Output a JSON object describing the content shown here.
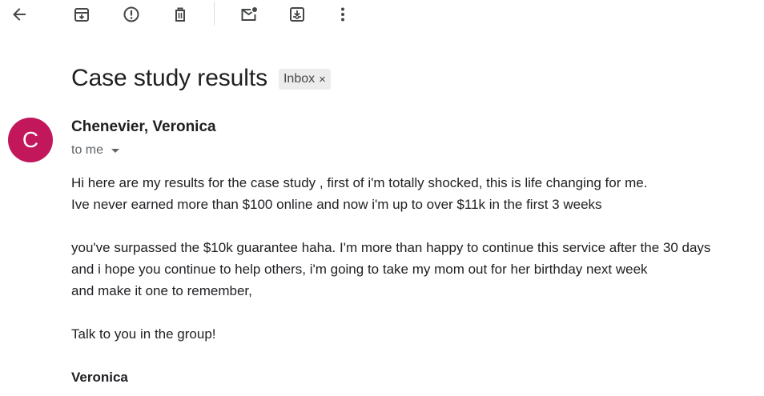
{
  "toolbar": {
    "icons": [
      "back-arrow-icon",
      "archive-icon",
      "report-spam-icon",
      "delete-icon",
      "mark-unread-icon",
      "move-to-icon",
      "more-vertical-icon"
    ]
  },
  "email": {
    "subject": "Case study results",
    "label": "Inbox",
    "label_remove": "×",
    "avatar_letter": "C",
    "avatar_color": "#c2185b",
    "sender": "Chenevier, Veronica",
    "recipient": "to me",
    "body": {
      "line1": "Hi here are my results for the case study , first of i'm totally shocked, this is life changing for me.",
      "line2": "Ive never earned more than $100 online and now i'm up to over $11k in the first 3 weeks",
      "line3": "you've surpassed the $10k guarantee haha. I'm more than happy to continue this service after the 30 days",
      "line4": "and i hope you continue to help others, i'm going to take my mom out for her birthday next week",
      "line5": "and make it one to remember,",
      "line6": "Talk to you in the group!",
      "signature": "Veronica"
    }
  }
}
